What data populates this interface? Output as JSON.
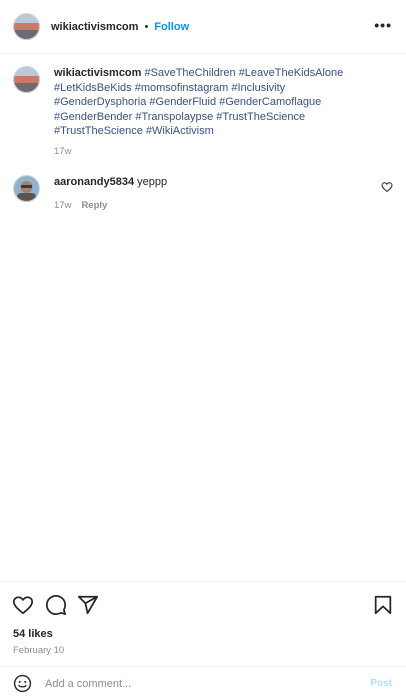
{
  "header": {
    "username": "wikiactivismcom",
    "separator": "•",
    "follow_label": "Follow",
    "more_label": "•••"
  },
  "caption": {
    "username": "wikiactivismcom",
    "hashtags": [
      "#SaveTheChildren",
      "#LeaveTheKidsAlone",
      "#LetKidsBeKids",
      "#momsofinstagram",
      "#Inclusivity",
      "#GenderDysphoria",
      "#GenderFluid",
      "#GenderCamoflague",
      "#GenderBender",
      "#Transpolaypse",
      "#TrustTheScience",
      "#TrustTheScience",
      "#WikiActivism"
    ],
    "time": "17w"
  },
  "comments": [
    {
      "username": "aaronandy5834",
      "text": "yeppp",
      "time": "17w",
      "reply_label": "Reply"
    }
  ],
  "actions": {
    "icons": [
      "heart-icon",
      "comment-icon",
      "share-icon",
      "bookmark-icon"
    ],
    "likes_text": "54 likes",
    "date_text": "February 10"
  },
  "add_comment": {
    "placeholder": "Add a comment...",
    "post_label": "Post"
  },
  "colors": {
    "accent": "#0095f6",
    "hashtag": "#385185",
    "muted": "#8e8e8e",
    "post_disabled": "#b2dffc"
  }
}
